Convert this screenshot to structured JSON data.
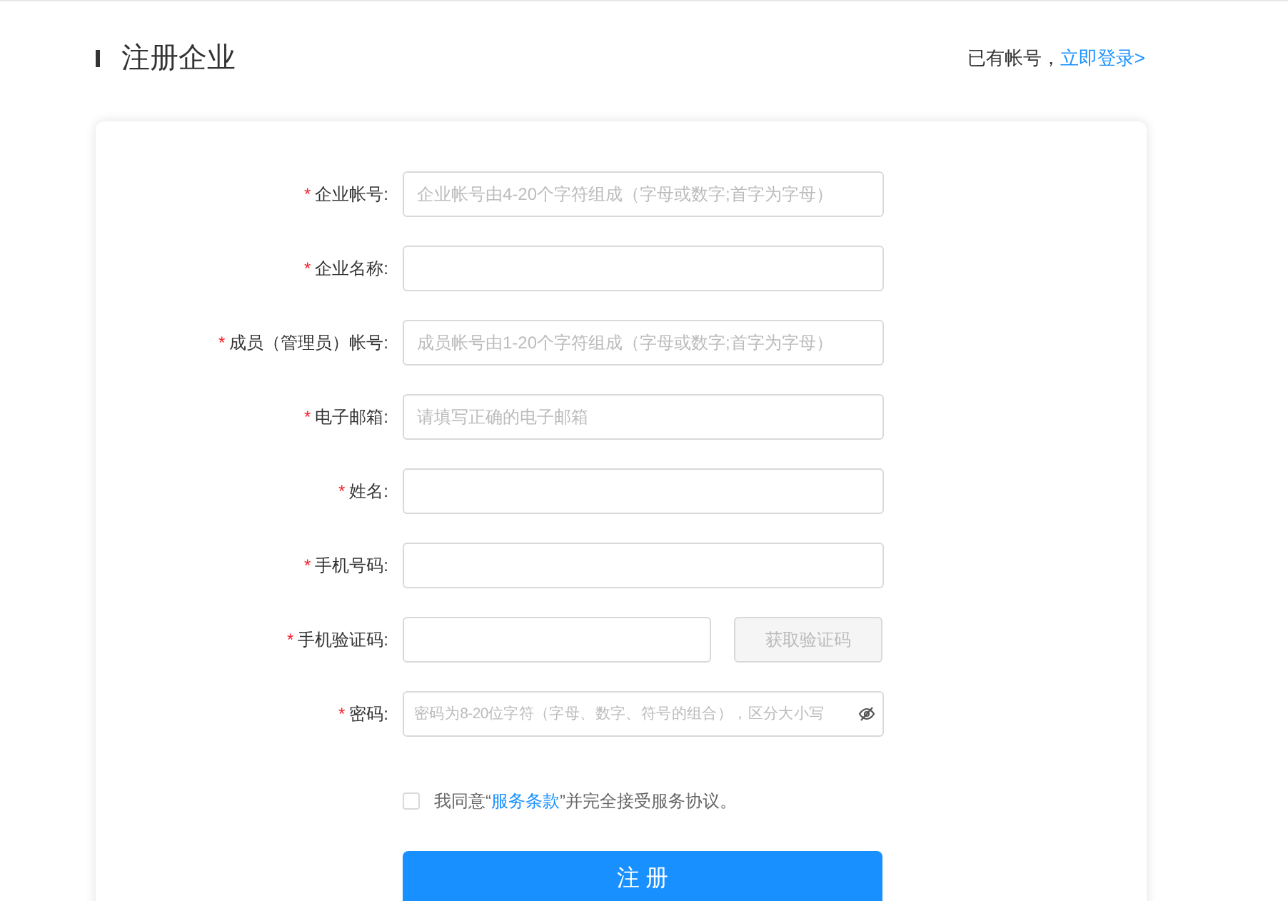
{
  "header": {
    "title": "注册企业",
    "login_prompt": "已有帐号，",
    "login_link": "立即登录>"
  },
  "form": {
    "fields": [
      {
        "kind": "text",
        "label": "企业帐号:",
        "required_mark": "*",
        "placeholder": "企业帐号由4-20个字符组成（字母或数字;首字为字母）"
      },
      {
        "kind": "text",
        "label": "企业名称:",
        "required_mark": "*"
      },
      {
        "kind": "text",
        "label": "成员（管理员）帐号:",
        "required_mark": "*",
        "placeholder": "成员帐号由1-20个字符组成（字母或数字;首字为字母）"
      },
      {
        "kind": "text",
        "label": "电子邮箱:",
        "required_mark": "*",
        "placeholder": "请填写正确的电子邮箱"
      },
      {
        "kind": "text",
        "label": "姓名:",
        "required_mark": "*"
      },
      {
        "kind": "text",
        "label": "手机号码:",
        "required_mark": "*"
      },
      {
        "kind": "sms",
        "label": "手机验证码:",
        "required_mark": "*",
        "button": "获取验证码"
      },
      {
        "kind": "password",
        "label": "密码:",
        "required_mark": "*",
        "placeholder": "密码为8-20位字符（字母、数字、符号的组合），区分大小写"
      }
    ],
    "agreement": {
      "checked": false,
      "before": "我同意“",
      "link": "服务条款",
      "after": "”并完全接受服务协议。"
    },
    "submit": "注 册"
  }
}
